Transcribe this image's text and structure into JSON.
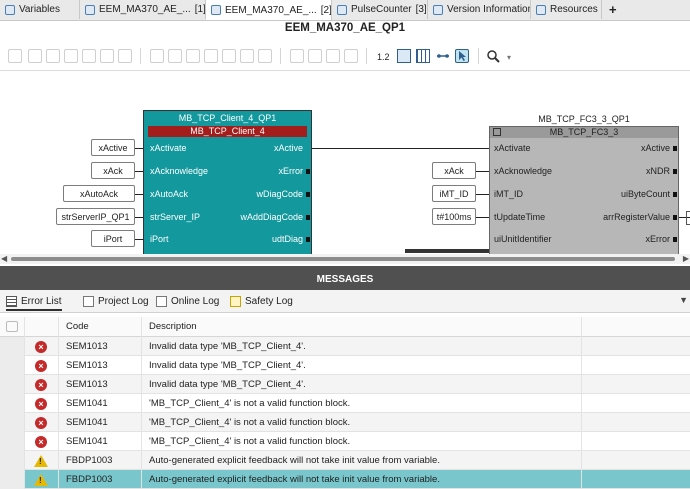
{
  "tabs": [
    {
      "label": "Variables",
      "active": false
    },
    {
      "label": "EEM_MA370_AE_...",
      "suffix": "[1]",
      "active": false
    },
    {
      "label": "EEM_MA370_AE_...",
      "suffix": "[2]",
      "active": true
    },
    {
      "label": "PulseCounter",
      "suffix": "[3]",
      "active": false
    },
    {
      "label": "Version Information",
      "active": false
    },
    {
      "label": "Resources",
      "active": false
    }
  ],
  "add_tab_label": "+",
  "editor_title": "EEM_MA370_AE_QP1",
  "toolbar": {
    "zoom_label": "1.2"
  },
  "diagram": {
    "block1": {
      "instance_label": "MB_TCP_Client_4_QP1",
      "type_label": "MB_TCP_Client_4",
      "inputs": [
        "xActivate",
        "xAcknowledge",
        "xAutoAck",
        "strServer_IP",
        "iPort"
      ],
      "outputs": [
        "xActive",
        "xError",
        "wDiagCode",
        "wAddDiagCode",
        "udtDiag"
      ],
      "input_variables": [
        "xActive",
        "xAck",
        "xAutoAck",
        "strServerIP_QP1",
        "iPort"
      ]
    },
    "block2": {
      "instance_label": "MB_TCP_FC3_3_QP1",
      "type_label": "MB_TCP_FC3_3",
      "inputs": [
        "xActivate",
        "xAcknowledge",
        "iMT_ID",
        "tUpdateTime",
        "uiUnitIdentifier"
      ],
      "outputs": [
        "xActive",
        "xNDR",
        "uiByteCount",
        "arrRegisterValue",
        "xError"
      ],
      "input_variables": [
        "xAck",
        "iMT_ID",
        "t#100ms"
      ]
    }
  },
  "messages": {
    "header": "MESSAGES",
    "tabs": [
      "Error List",
      "Project Log",
      "Online Log",
      "Safety Log"
    ],
    "columns": {
      "code": "Code",
      "description": "Description"
    },
    "rows": [
      {
        "severity": "error",
        "code": "SEM1013",
        "description": "Invalid data type 'MB_TCP_Client_4'."
      },
      {
        "severity": "error",
        "code": "SEM1013",
        "description": "Invalid data type 'MB_TCP_Client_4'."
      },
      {
        "severity": "error",
        "code": "SEM1013",
        "description": "Invalid data type 'MB_TCP_Client_4'."
      },
      {
        "severity": "error",
        "code": "SEM1041",
        "description": "'MB_TCP_Client_4' is not a valid function block."
      },
      {
        "severity": "error",
        "code": "SEM1041",
        "description": "'MB_TCP_Client_4' is not a valid function block."
      },
      {
        "severity": "error",
        "code": "SEM1041",
        "description": "'MB_TCP_Client_4' is not a valid function block."
      },
      {
        "severity": "warning",
        "code": "FBDP1003",
        "description": "Auto-generated explicit feedback will not take init value from variable."
      },
      {
        "severity": "warning",
        "code": "FBDP1003",
        "description": "Auto-generated explicit feedback will not take init value from variable.",
        "selected": true
      }
    ]
  },
  "colors": {
    "block1": "#13989d",
    "block1_header": "#a31d1d",
    "selected_row": "#79c7cc"
  }
}
